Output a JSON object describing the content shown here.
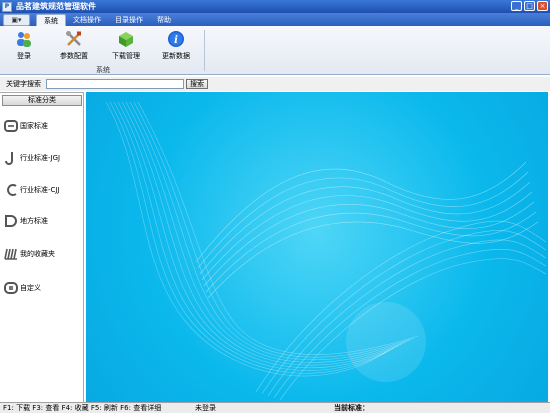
{
  "window": {
    "title": "品茗建筑规范管理软件"
  },
  "tabs": [
    {
      "label": "系统",
      "active": true
    },
    {
      "label": "文档操作",
      "active": false
    },
    {
      "label": "目录操作",
      "active": false
    },
    {
      "label": "帮助",
      "active": false
    }
  ],
  "ribbon": {
    "group_label": "系统",
    "buttons": [
      {
        "label": "登录",
        "icon": "users-icon"
      },
      {
        "label": "参数配置",
        "icon": "tools-icon"
      },
      {
        "label": "下载管理",
        "icon": "download-box-icon"
      },
      {
        "label": "更新数据",
        "icon": "info-icon"
      }
    ]
  },
  "search": {
    "label": "关键字搜索",
    "value": "",
    "button": "搜索"
  },
  "sidebar": {
    "header": "标准分类",
    "items": [
      {
        "label": "国家标准"
      },
      {
        "label": "行业标准-JGJ"
      },
      {
        "label": "行业标准-CJJ"
      },
      {
        "label": "地方标准"
      },
      {
        "label": "我的收藏夹"
      },
      {
        "label": "自定义"
      }
    ]
  },
  "statusbar": {
    "keys": "F1: 下载 F3: 查看 F4: 收藏 F5: 刷新 F6: 查看详细",
    "login": "未登录",
    "current": "当前标准："
  },
  "colors": {
    "title_bar": "#2a5fc4",
    "main_bg": "#0ab8ec",
    "ribbon_bg": "#e8edf5"
  }
}
